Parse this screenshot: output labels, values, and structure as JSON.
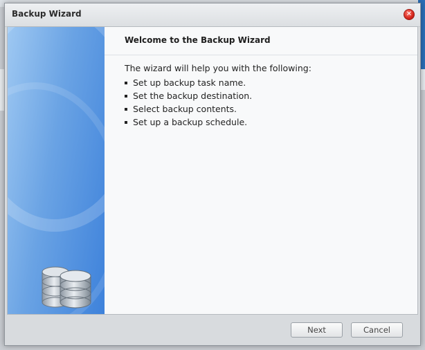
{
  "dialog": {
    "title": "Backup Wizard",
    "close_icon": "close-icon"
  },
  "content": {
    "heading": "Welcome to the Backup Wizard",
    "intro": "The wizard will help you with the following:",
    "steps": [
      "Set up backup task name.",
      "Set the backup destination.",
      "Select backup contents.",
      "Set up a backup schedule."
    ]
  },
  "side_panel": {
    "icon": "database-stack-icon",
    "accent": "#3e82db"
  },
  "footer": {
    "next_label": "Next",
    "cancel_label": "Cancel"
  }
}
